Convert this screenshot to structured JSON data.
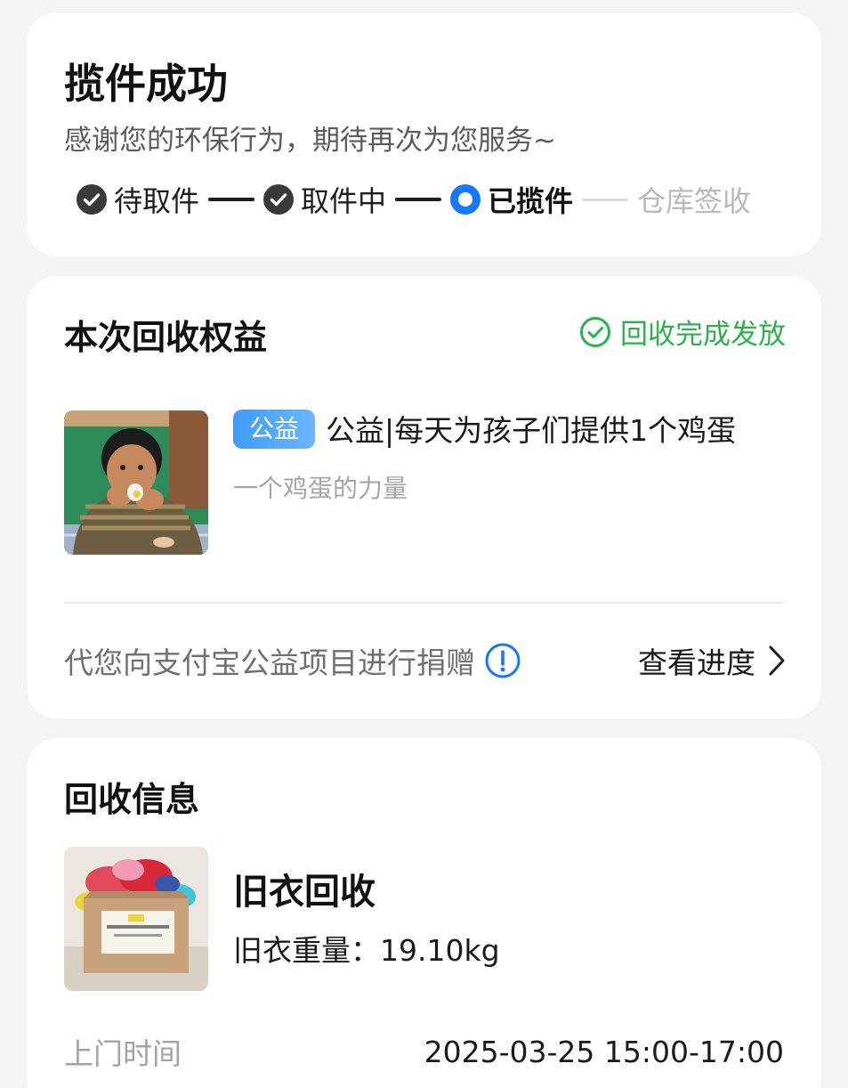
{
  "status_card": {
    "title": "揽件成功",
    "subtitle": "感谢您的环保行为，期待再次为您服务~",
    "steps": [
      {
        "label": "待取件",
        "state": "done"
      },
      {
        "label": "取件中",
        "state": "done"
      },
      {
        "label": "已揽件",
        "state": "current"
      },
      {
        "label": "仓库签收",
        "state": "pending"
      }
    ],
    "step_icons": {
      "done": "check-circle-icon",
      "current": "radio-dot-icon",
      "pending": "none"
    }
  },
  "benefit_card": {
    "title": "本次回收权益",
    "status_label": "回收完成发放",
    "status_icon": "check-circle-outline-icon",
    "status_color": "#2bb24c",
    "project": {
      "tag": "公益",
      "title": "公益|每天为孩子们提供1个鸡蛋",
      "subtitle": "一个鸡蛋的力量"
    },
    "donate_text": "代您向支付宝公益项目进行捐赠",
    "info_icon": "exclamation-circle-icon",
    "progress_link": "查看进度",
    "accent_color": "#1677ff"
  },
  "info_card": {
    "title": "回收信息",
    "item_name": "旧衣回收",
    "weight_label": "旧衣重量：",
    "weight_value": "19.10kg",
    "time_label": "上门时间",
    "time_value": "2025-03-25 15:00-17:00"
  }
}
